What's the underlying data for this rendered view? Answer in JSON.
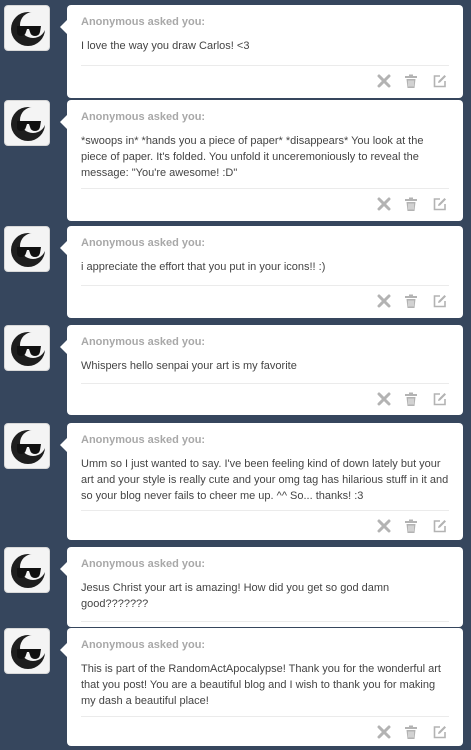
{
  "colors": {
    "background": "#36465d",
    "card": "#ffffff",
    "asker": "#a8a8a8",
    "icon": "#b3b3b3"
  },
  "icons": {
    "avatar": "sunglasses-moon-avatar-icon",
    "dismiss": "close-x-icon",
    "delete": "trash-icon",
    "edit": "edit-pencil-icon"
  },
  "asks": [
    {
      "asker": "Anonymous asked you:",
      "question": "I love the way you draw Carlos! <3"
    },
    {
      "asker": "Anonymous asked you:",
      "question": "*swoops in* *hands you a piece of paper* *disappears* You look at the piece of paper. It's folded. You unfold it unceremoniously to reveal the message: \"You're awesome! :D\""
    },
    {
      "asker": "Anonymous asked you:",
      "question": "i appreciate the effort that you put in your icons!! :)"
    },
    {
      "asker": "Anonymous asked you:",
      "question": "Whispers hello senpai your art is my favorite"
    },
    {
      "asker": "Anonymous asked you:",
      "question": "Umm so I just wanted to say. I've been feeling kind of down lately but your art and your style is really cute and your omg tag has hilarious stuff in it and so your blog never fails to cheer me up. ^^ So... thanks! :3"
    },
    {
      "asker": "Anonymous asked you:",
      "question": "Jesus Christ your art is amazing! How did you get so god damn good???????"
    },
    {
      "asker": "Anonymous asked you:",
      "question": "This is part of the RandomActApocalypse! Thank you for the wonderful art that you post! You are a beautiful blog and I wish to thank you for making my dash a beautiful place!"
    }
  ]
}
